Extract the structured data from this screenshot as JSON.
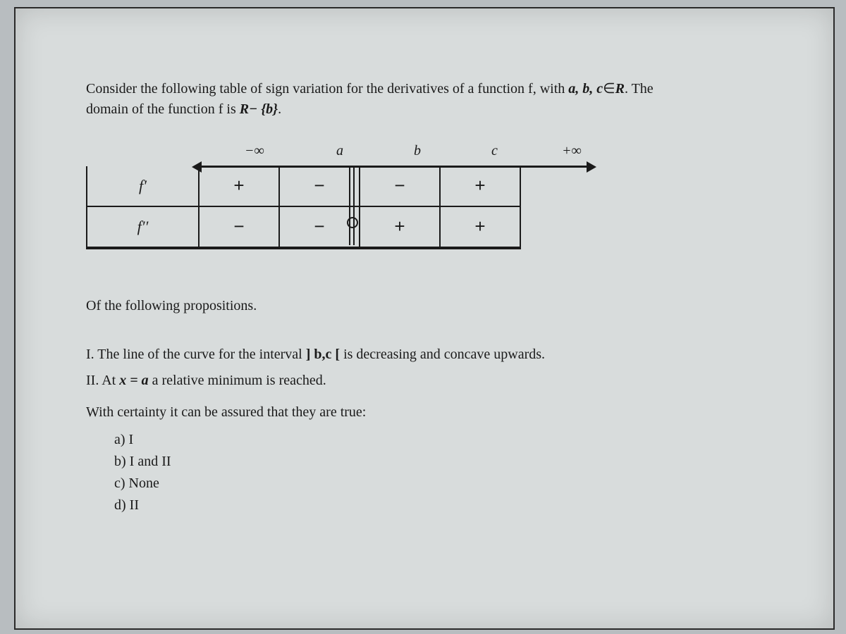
{
  "intro": {
    "line1_prefix": "Consider the following table of sign variation for the derivatives of a function f, with ",
    "abc": "a, b, c",
    "in": "∈",
    "set": "R",
    "line1_suffix": ". The",
    "line2": "domain of the function f is ",
    "domain": "R− {b}",
    "period": "."
  },
  "table": {
    "axis": {
      "minus_inf": "−∞",
      "a": "a",
      "b": "b",
      "c": "c",
      "plus_inf": "+∞"
    },
    "rows": {
      "fprime_label": "f′",
      "fprime": [
        "+",
        "−",
        "−",
        "+"
      ],
      "fsecond_label": "f′′",
      "fsecond": [
        "−",
        "−",
        "+",
        "+"
      ]
    }
  },
  "subhead": "Of the following propositions.",
  "props": {
    "p1_prefix": "I. The line of the curve for the interval  ",
    "p1_interval": "] b,c [",
    "p1_suffix": "  is decreasing and concave upwards.",
    "p2_prefix": "II. At ",
    "p2_eq": "x = a",
    "p2_suffix": " a relative minimum is reached."
  },
  "lead": "With certainty it can be assured that they are true:",
  "choices": {
    "a": "a)   I",
    "b": "b)   I and II",
    "c": "c)   None",
    "d": "d)   II"
  }
}
